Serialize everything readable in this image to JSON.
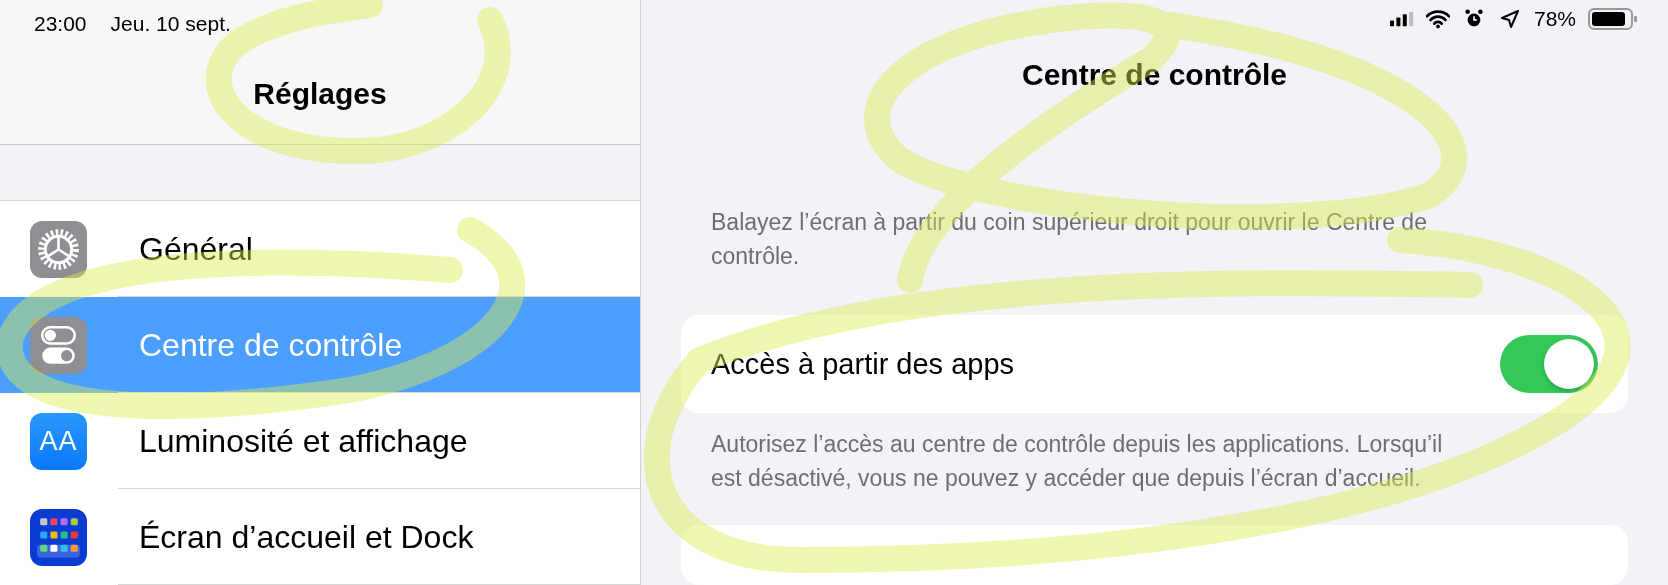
{
  "status_bar": {
    "time": "23:00",
    "date": "Jeu. 10 sept.",
    "battery": "78%"
  },
  "sidebar": {
    "title": "Réglages",
    "items": [
      {
        "label": "Général",
        "kind": "gear",
        "selected": false
      },
      {
        "label": "Centre de contrôle",
        "kind": "switches",
        "selected": true
      },
      {
        "label": "Luminosité et affichage",
        "kind": "text-size",
        "selected": false,
        "icon_text": "AA"
      },
      {
        "label": "Écran d’accueil et Dock",
        "kind": "grid",
        "selected": false
      }
    ]
  },
  "detail": {
    "title": "Centre de contrôle",
    "description": "Balayez l’écran à partir du coin supérieur droit pour ouvrir le Centre de contrôle.",
    "toggle": {
      "label": "Accès à partir des apps",
      "on": true
    },
    "footer": "Autorisez l’accès au centre de contrôle depuis les applications. Lorsqu’il est désactivé, vous ne pouvez y accéder que depuis l’écran d’accueil."
  }
}
